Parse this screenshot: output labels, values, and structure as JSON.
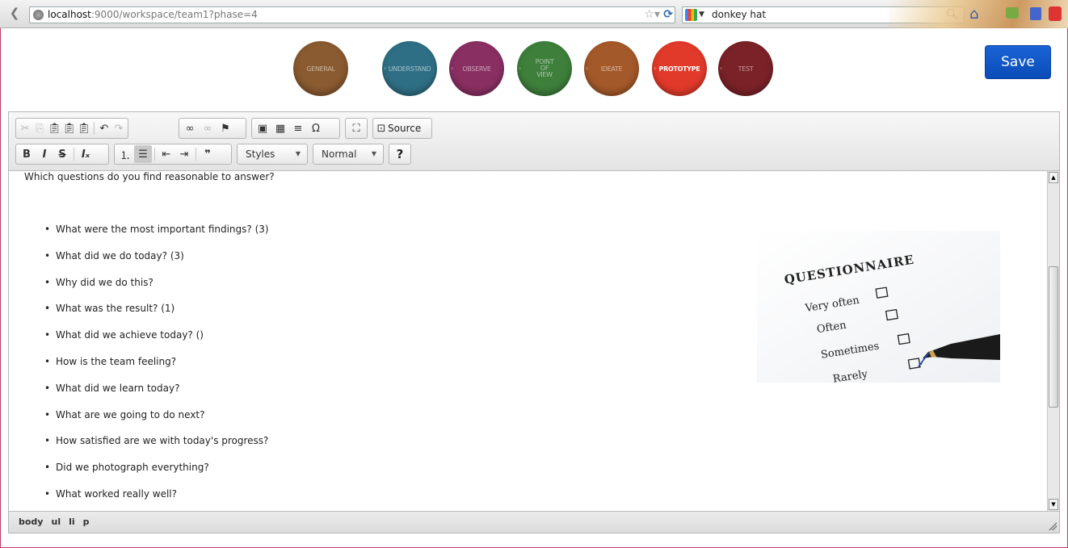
{
  "browser": {
    "url_host": "localhost",
    "url_rest": ":9000/workspace/team1?phase=4",
    "search_query": "donkey hat"
  },
  "phases": [
    {
      "label": "GENERAL",
      "color": "#8a5a30"
    },
    {
      "label": "UNDERSTAND",
      "color": "#2f6f85"
    },
    {
      "label": "OBSERVE",
      "color": "#8a2f62"
    },
    {
      "label": "POINT OF VIEW",
      "color": "#3d7f3b"
    },
    {
      "label": "IDEATE",
      "color": "#a4592a"
    },
    {
      "label": "PROTOTYPE",
      "color": "#e23a2a",
      "active": true
    },
    {
      "label": "TEST",
      "color": "#7a2228"
    }
  ],
  "save_label": "Save",
  "toolbar": {
    "source_label": "Source",
    "styles_label": "Styles",
    "format_label": "Normal",
    "help_label": "?"
  },
  "content": {
    "intro": "Which questions do you find reasonable to answer?",
    "questions": [
      "What were the most important findings? (3)",
      "What did we do today? (3)",
      "Why did we do this?",
      "What was the result? (1)",
      "What did we achieve today? ()",
      "How is the team feeling?",
      "What did we learn today?",
      "What are we going to do next?",
      "How satisfied are we with today's progress?",
      "Did we photograph everything?",
      "What worked really well?"
    ],
    "image": {
      "title": "QUESTIONNAIRE",
      "options": [
        "Very often",
        "Often",
        "Sometimes",
        "Rarely"
      ]
    }
  },
  "elements_path": [
    "body",
    "ul",
    "li",
    "p"
  ]
}
